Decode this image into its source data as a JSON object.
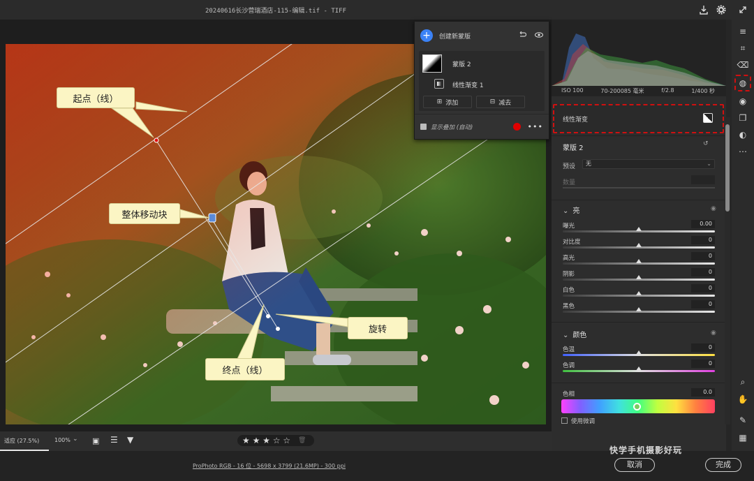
{
  "window": {
    "file_title": "20240616长沙营瑞酒店-115-编辑.tif  -  TIFF"
  },
  "mask_panel": {
    "create_label": "创建新蒙版",
    "mask_name": "蒙版 2",
    "component_name": "线性渐变 1",
    "add_label": "添加",
    "subtract_label": "减去",
    "overlay_label": "显示叠加 (自动)",
    "overlay_color": "#e00000"
  },
  "callouts": {
    "start_point": "起点（线）",
    "move_block": "整体移动块",
    "rotate": "旋转",
    "end_point": "终点（线）"
  },
  "histogram_info": {
    "iso": "ISO 100",
    "lens": "70-200085 毫米",
    "aperture": "f/2.8",
    "shutter": "1/400 秒"
  },
  "right_panel": {
    "linear_gradient_label": "线性渐变",
    "mask_name": "蒙版 2",
    "preset_label": "预设",
    "preset_value": "无",
    "amount_label": "数量",
    "light_section": "亮",
    "sliders_light": [
      {
        "label": "曝光",
        "value": "0.00",
        "pos": 0.5
      },
      {
        "label": "对比度",
        "value": "0",
        "pos": 0.5
      },
      {
        "label": "高光",
        "value": "0",
        "pos": 0.5
      },
      {
        "label": "阴影",
        "value": "0",
        "pos": 0.5
      },
      {
        "label": "白色",
        "value": "0",
        "pos": 0.5
      },
      {
        "label": "黑色",
        "value": "0",
        "pos": 0.5
      }
    ],
    "color_section": "颜色",
    "sliders_color": [
      {
        "label": "色温",
        "value": "0",
        "pos": 0.5
      },
      {
        "label": "色调",
        "value": "0",
        "pos": 0.5
      }
    ],
    "hue_label": "色相",
    "hue_value": "0.0",
    "fine_adjust_label": "使用微调"
  },
  "bottom_bar": {
    "zoom_fit": "适应 (27.5%)",
    "zoom_100": "100%",
    "rating": "★ ★ ★ ☆ ☆",
    "rating_value": 3,
    "status_text": "ProPhoto RGB - 16 位 - 5698 x 3799 (21.6MP) - 300 ppi"
  },
  "footer": {
    "watermark": "快学手机摄影好玩",
    "cancel_label": "取消",
    "done_label": "完成"
  },
  "colors": {
    "accent": "#3b82f6",
    "highlight_border": "#d01010",
    "callout_bg": "#fbf5c4"
  }
}
